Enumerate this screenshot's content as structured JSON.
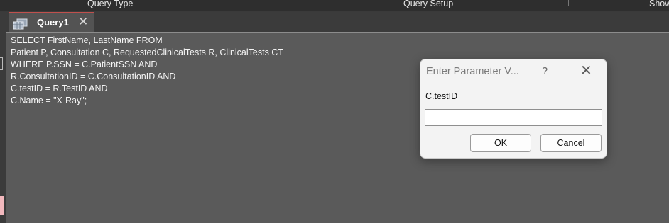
{
  "ribbon": {
    "groups": [
      "Query Type",
      "Query Setup",
      "Show"
    ]
  },
  "document_tab": {
    "label": "Query1",
    "icon": "query-grid-icon",
    "close_icon": "close-icon"
  },
  "editor": {
    "sql_lines": [
      "SELECT FirstName, LastName FROM",
      "Patient P, Consultation C, RequestedClinicalTests R, ClinicalTests CT",
      "WHERE P.SSN = C.PatientSSN AND",
      "R.ConsultationID = C.ConsultationID AND",
      "C.testID = R.TestID AND",
      "C.Name = \"X-Ray\";"
    ]
  },
  "dialog": {
    "title": "Enter Parameter V...",
    "help": "?",
    "prompt": "C.testID",
    "input_value": "",
    "ok_label": "OK",
    "cancel_label": "Cancel"
  },
  "colors": {
    "tab_accent": "#c0504d",
    "editor_bg": "#5a5a5a",
    "chrome_dark": "#2e2e2e"
  }
}
